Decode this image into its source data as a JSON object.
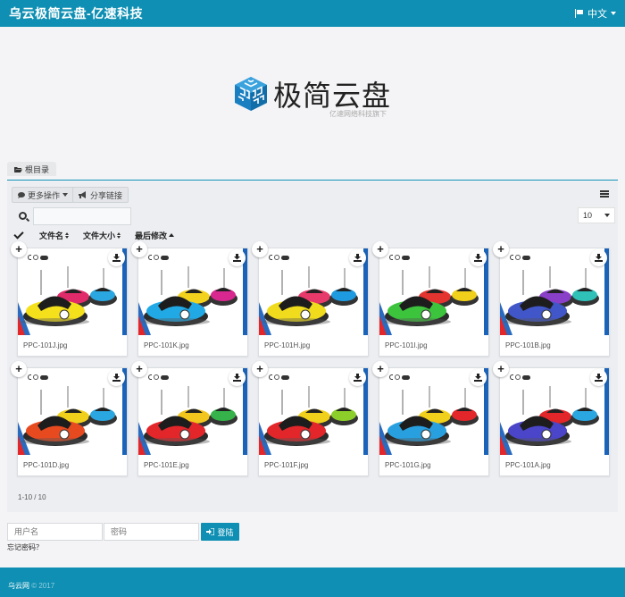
{
  "topbar": {
    "brand": "乌云极简云盘-亿速科技",
    "lang": "中文"
  },
  "logo": {
    "title": "极简云盘",
    "subtitle": "亿速网络科技旗下"
  },
  "breadcrumb": {
    "root": "根目录"
  },
  "toolbar": {
    "more_label": "更多操作",
    "share_label": "分享链接"
  },
  "search": {
    "placeholder": ""
  },
  "per_page": "10",
  "columns": {
    "name": "文件名",
    "size": "文件大小",
    "modified": "最后修改"
  },
  "files": [
    {
      "name": "PPC-101J.jpg"
    },
    {
      "name": "PPC-101K.jpg"
    },
    {
      "name": "PPC-101H.jpg"
    },
    {
      "name": "PPC-101I.jpg"
    },
    {
      "name": "PPC-101B.jpg"
    },
    {
      "name": "PPC-101D.jpg"
    },
    {
      "name": "PPC-101E.jpg"
    },
    {
      "name": "PPC-101F.jpg"
    },
    {
      "name": "PPC-101G.jpg"
    },
    {
      "name": "PPC-101A.jpg"
    }
  ],
  "pagination": "1-10 / 10",
  "login": {
    "user_placeholder": "用户名",
    "pass_placeholder": "密码",
    "button": "登陆",
    "forgot": "忘记密码？"
  },
  "footer": {
    "site": "乌云网",
    "copyright": "© 2017"
  },
  "colors": {
    "accent": "#0e8fb3"
  }
}
